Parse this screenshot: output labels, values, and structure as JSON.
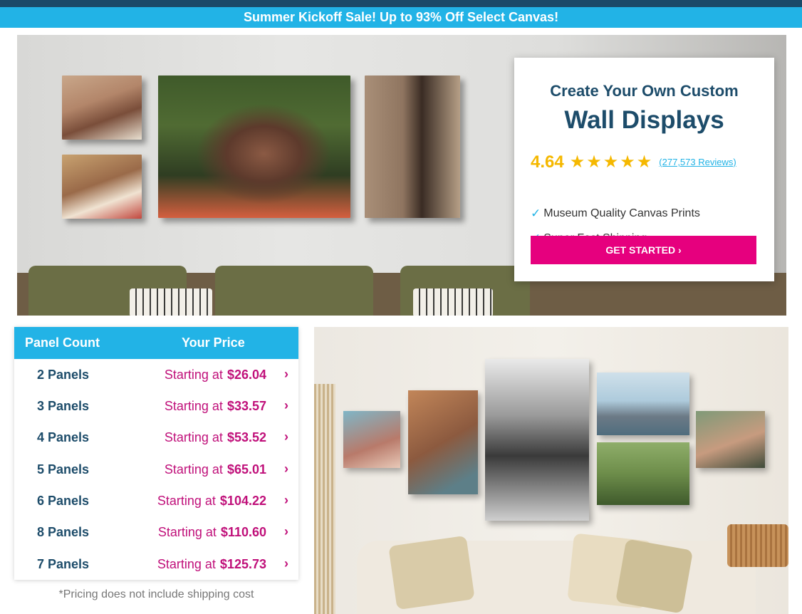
{
  "promo": {
    "text": "Summer Kickoff Sale! Up to 93% Off Select Canvas!"
  },
  "hero": {
    "subtitle": "Create Your Own Custom",
    "title": "Wall Displays",
    "rating": "4.64",
    "stars": "★★★★★",
    "reviews": "(277,573 Reviews)",
    "features": [
      "Museum Quality Canvas Prints",
      "Super Fast Shipping"
    ],
    "check": "✓",
    "cta_label": "GET STARTED ›"
  },
  "pricing": {
    "col_panel": "Panel Count",
    "col_price": "Your Price",
    "starting_text": "Starting at",
    "chevron": "›",
    "rows": [
      {
        "panels": "2 Panels",
        "price": "$26.04"
      },
      {
        "panels": "3 Panels",
        "price": "$33.57"
      },
      {
        "panels": "4 Panels",
        "price": "$53.52"
      },
      {
        "panels": "5 Panels",
        "price": "$65.01"
      },
      {
        "panels": "6 Panels",
        "price": "$104.22"
      },
      {
        "panels": "8 Panels",
        "price": "$110.60"
      },
      {
        "panels": "7 Panels",
        "price": "$125.73"
      }
    ],
    "note": "*Pricing does not include shipping cost"
  },
  "colors": {
    "brand_blue": "#22b3e6",
    "navy": "#1d4c6a",
    "magenta": "#e6007e",
    "price_pink": "#c0107a",
    "star_gold": "#f5b800"
  }
}
